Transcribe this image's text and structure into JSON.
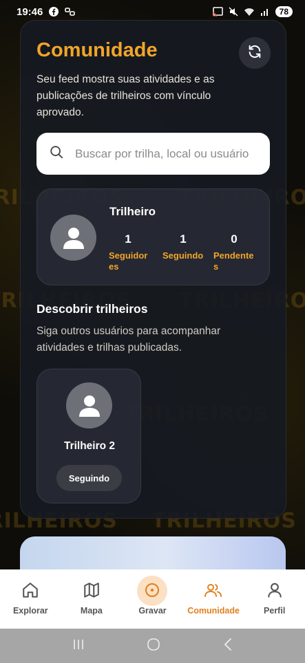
{
  "status_bar": {
    "time": "19:46",
    "battery": "78",
    "icons": [
      "facebook-icon",
      "link-icon",
      "cast-icon",
      "mute-icon",
      "wifi-icon",
      "signal-icon"
    ]
  },
  "header": {
    "title": "Comunidade",
    "subtitle": "Seu feed mostra suas atividades e as publicações de trilheiros com vínculo aprovado.",
    "refresh_icon": "refresh-icon"
  },
  "search": {
    "placeholder": "Buscar por trilha, local ou usuário"
  },
  "profile": {
    "name": "Trilheiro",
    "stats": [
      {
        "value": "1",
        "label": "Seguidores"
      },
      {
        "value": "1",
        "label": "Seguindo"
      },
      {
        "value": "0",
        "label": "Pendentes"
      }
    ]
  },
  "discover": {
    "title": "Descobrir trilheiros",
    "subtitle": "Siga outros usuários para acompanhar atividades e trilhas publicadas.",
    "users": [
      {
        "name": "Trilheiro 2",
        "button": "Seguindo"
      }
    ]
  },
  "bottom_nav": {
    "active": "Comunidade",
    "items": [
      {
        "label": "Explorar",
        "icon": "home-icon"
      },
      {
        "label": "Mapa",
        "icon": "map-icon"
      },
      {
        "label": "Gravar",
        "icon": "record-icon"
      },
      {
        "label": "Comunidade",
        "icon": "community-icon"
      },
      {
        "label": "Perfil",
        "icon": "profile-icon"
      }
    ]
  },
  "colors": {
    "accent": "#f2a52a",
    "active_nav": "#e07f1f",
    "card_bg": "#161a22"
  }
}
